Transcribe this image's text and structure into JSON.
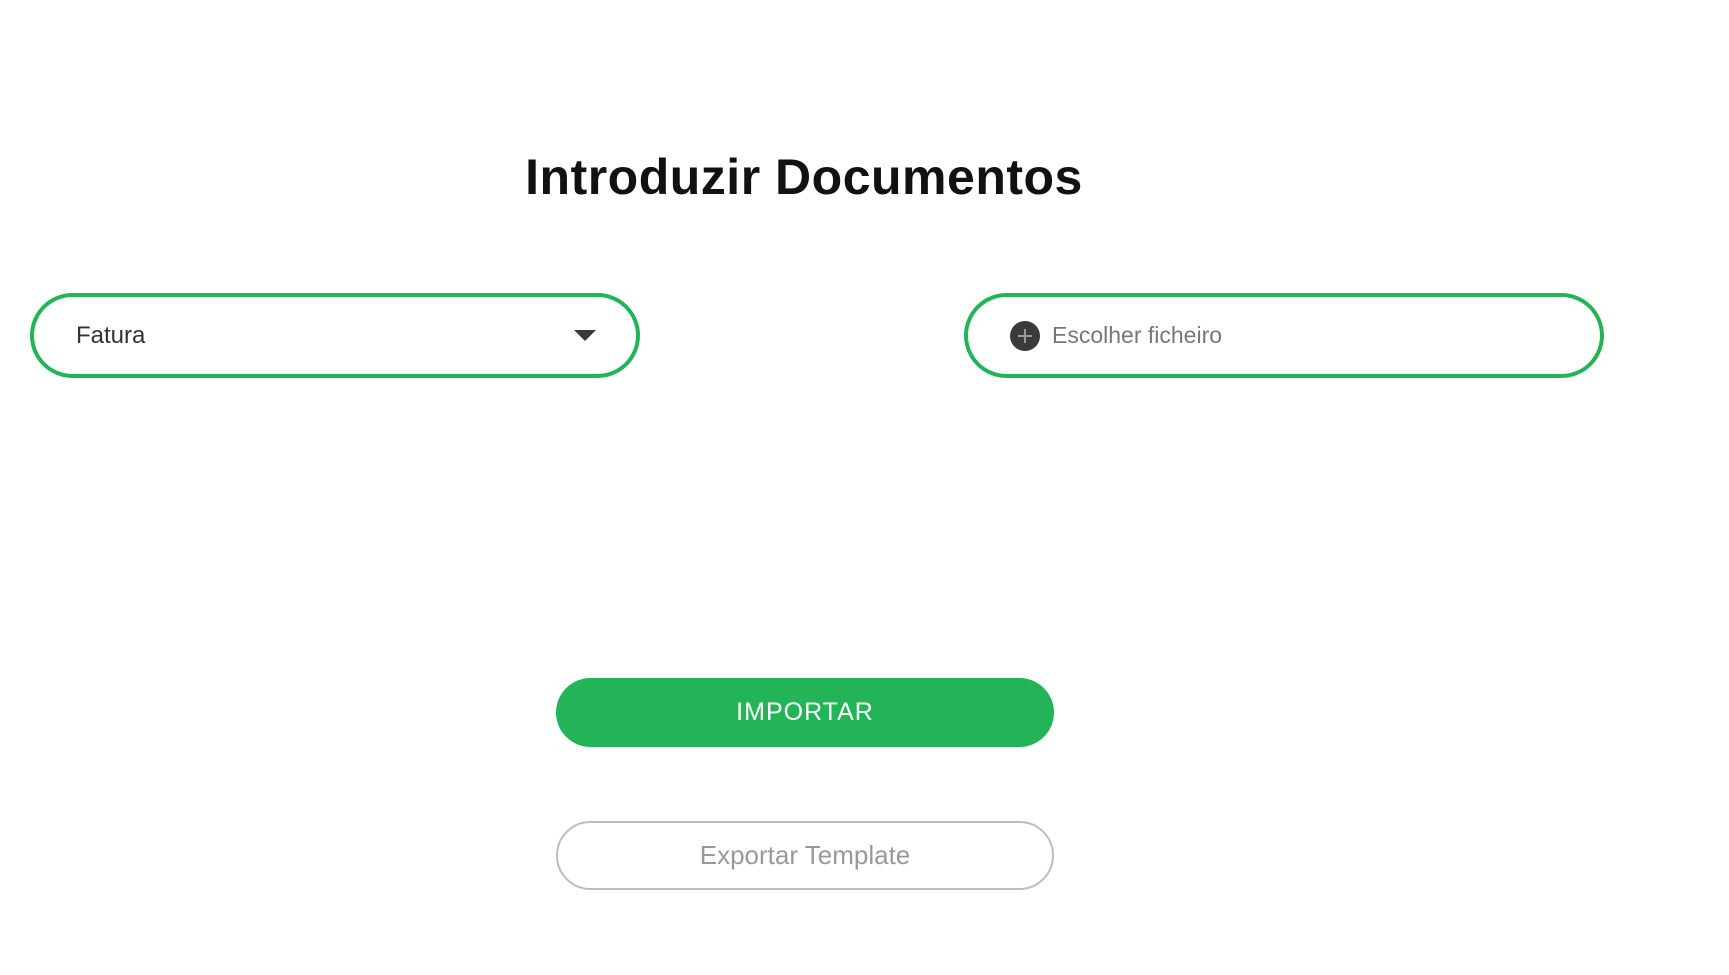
{
  "page": {
    "title": "Introduzir Documentos"
  },
  "document_type_select": {
    "selected_value": "Fatura"
  },
  "file_picker": {
    "placeholder": "Escolher ficheiro"
  },
  "actions": {
    "import_label": "IMPORTAR",
    "export_label": "Exportar Template"
  },
  "colors": {
    "accent": "#22b456",
    "title_text": "#111111",
    "secondary_border": "#bdbdbd"
  },
  "icons": {
    "select_caret": "chevron-down-icon",
    "file_add": "plus-circle-icon"
  }
}
